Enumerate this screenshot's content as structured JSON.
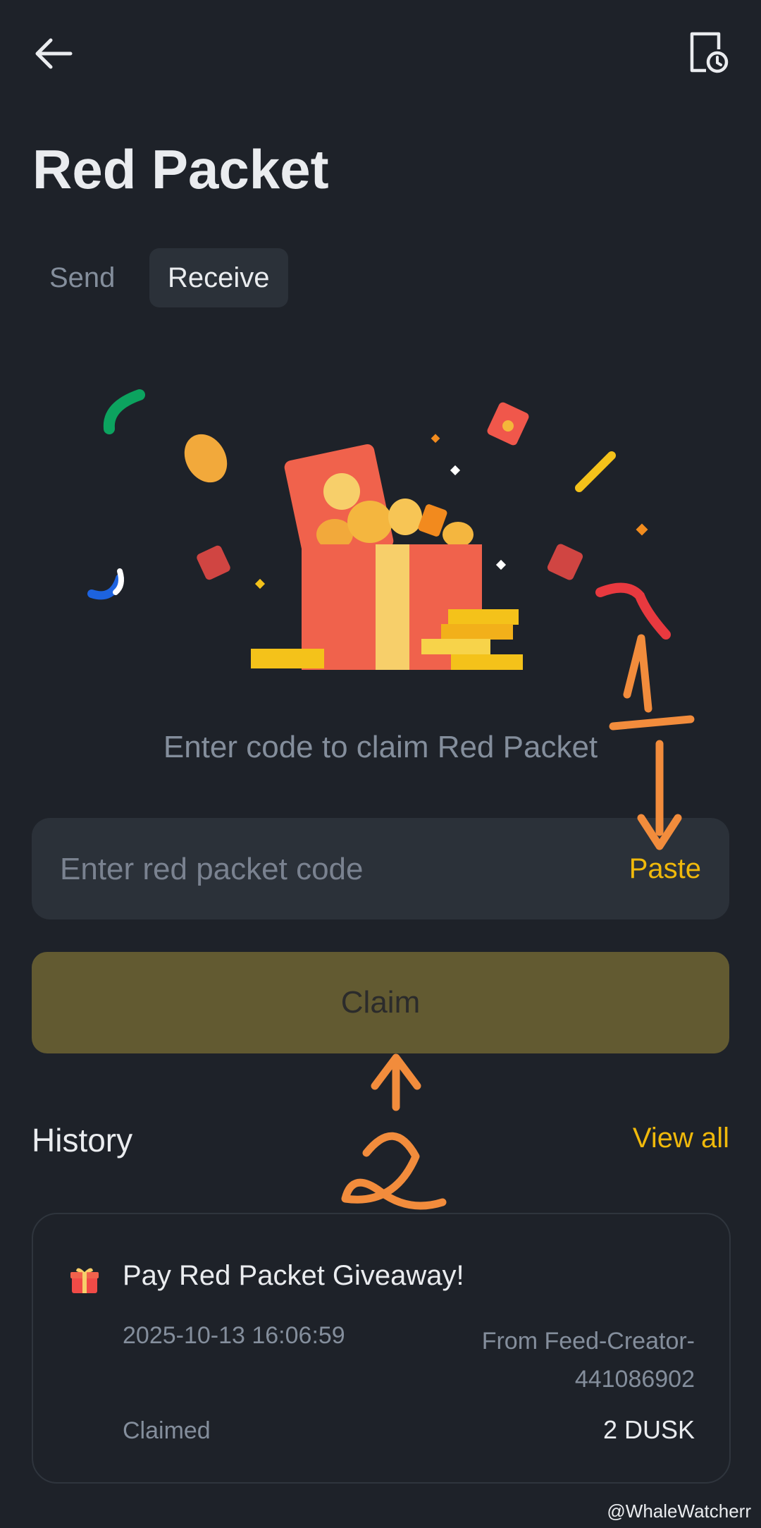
{
  "header": {
    "back_icon": "arrow-left-icon",
    "history_icon": "history-document-clock-icon"
  },
  "page": {
    "title": "Red Packet"
  },
  "tabs": [
    {
      "label": "Send",
      "active": false
    },
    {
      "label": "Receive",
      "active": true
    }
  ],
  "receive": {
    "prompt": "Enter code to claim Red Packet",
    "code_placeholder": "Enter red packet code",
    "paste_label": "Paste",
    "claim_label": "Claim"
  },
  "history": {
    "title": "History",
    "view_all_label": "View all",
    "items": [
      {
        "title": "Pay Red Packet Giveaway!",
        "icon": "gift-icon",
        "datetime": "2025-10-13 16:06:59",
        "from": "From Feed-Creator-441086902",
        "status": "Claimed",
        "amount": "2 DUSK"
      }
    ]
  },
  "annotations": {
    "marks": [
      "1",
      "2"
    ],
    "color": "#f28c3c"
  },
  "watermark": "@WhaleWatcherr",
  "colors": {
    "accent": "#f0b90b",
    "background": "#1e2229",
    "surface": "#2b3139",
    "claim_disabled": "#625a31"
  }
}
